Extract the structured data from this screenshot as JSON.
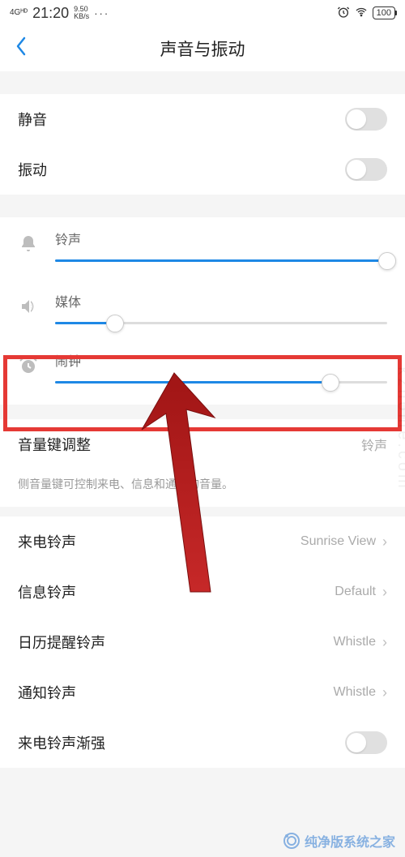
{
  "statusbar": {
    "net_type": "4Gᴴᴰ",
    "time": "21:20",
    "speed": "9.50",
    "speed_unit": "KB/s",
    "dots": "···",
    "battery": "100"
  },
  "header": {
    "title": "声音与振动"
  },
  "toggles": {
    "mute": {
      "label": "静音",
      "on": false
    },
    "vibrate": {
      "label": "振动",
      "on": false
    }
  },
  "sliders": {
    "ringtone": {
      "label": "铃声",
      "value": 100
    },
    "media": {
      "label": "媒体",
      "value": 18
    },
    "alarm": {
      "label": "闹钟",
      "value": 83
    }
  },
  "volume_key": {
    "label": "音量键调整",
    "value": "铃声",
    "hint": "侧音量键可控制来电、信息和通知的音量。"
  },
  "ringtones": {
    "incoming": {
      "label": "来电铃声",
      "value": "Sunrise View"
    },
    "message": {
      "label": "信息铃声",
      "value": "Default"
    },
    "calendar": {
      "label": "日历提醒铃声",
      "value": "Whistle"
    },
    "notify": {
      "label": "通知铃声",
      "value": "Whistle"
    },
    "cresc": {
      "label": "来电铃声渐强",
      "on": false
    }
  },
  "watermark": {
    "side": "kzhome.com",
    "bottom": "纯净版系统之家"
  },
  "chart_data": null,
  "annotation": {
    "highlight_target": "alarm-slider",
    "arrow_from": "below",
    "arrow_color": "#b71c1c"
  }
}
